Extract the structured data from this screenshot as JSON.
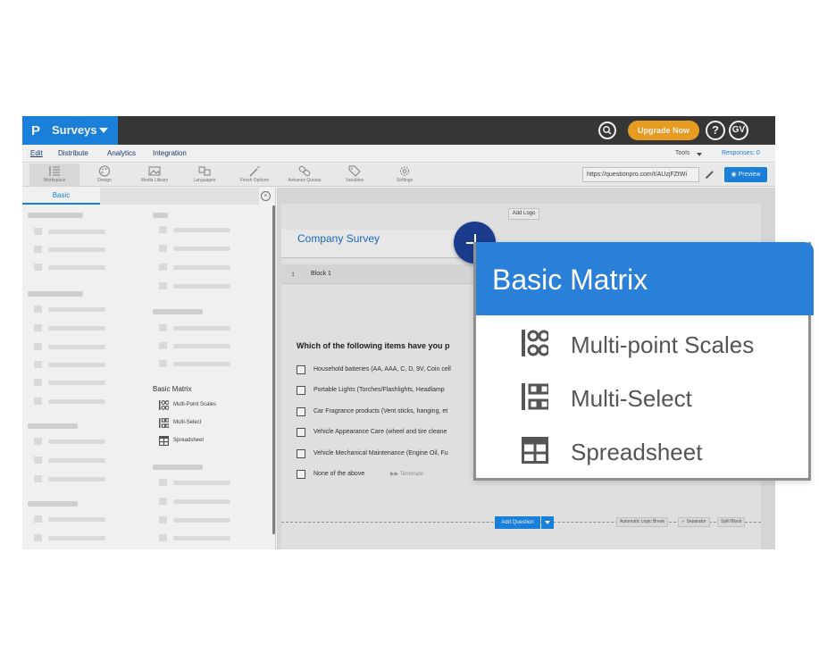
{
  "topbar": {
    "logo": "P",
    "app_name": "Surveys",
    "upgrade_label": "Upgrade Now",
    "help_label": "?",
    "avatar_initials": "GV"
  },
  "nav": {
    "tabs": [
      "Edit",
      "Distribute",
      "Analytics",
      "Integration"
    ],
    "tools_label": "Tools",
    "responses_label": "Responses: 0"
  },
  "toolbar": {
    "items": [
      "Workspace",
      "Design",
      "Media Library",
      "Languages",
      "Finish Options",
      "Advance Quotas",
      "Variables",
      "Settings"
    ],
    "url": "https://questionpro.com/t/AUzjFZtWi",
    "preview_label": "Preview"
  },
  "panel": {
    "tab_label": "Basic",
    "basic_matrix": {
      "heading": "Basic Matrix",
      "items": [
        "Multi-Point Scales",
        "Multi-Select",
        "Spreadsheet"
      ]
    }
  },
  "editor": {
    "add_logo": "Add Logo",
    "survey_title": "Company Survey",
    "block_label": "Block 1",
    "question": "Which of the following items have you p",
    "options": [
      "Household batteries (AA, AAA, C, D, 9V, Coin cell",
      "Portable Lights (Torches/Flashlights, Headlamp",
      "Car Fragrance products (Vent sticks, hanging, et",
      "Vehicle Appearance Care (wheel and tire cleane",
      "Vehicle Mechanical Maintenance (Engine Oil, Fu",
      "None of the above"
    ],
    "terminate_label": "Terminate",
    "add_question": "Add Question",
    "footer_actions": [
      "Automatic Logic Break",
      "Separator",
      "Split Block"
    ]
  },
  "popup": {
    "title": "Basic Matrix",
    "items": [
      "Multi-point Scales",
      "Multi-Select",
      "Spreadsheet"
    ]
  },
  "colors": {
    "brand_blue": "#1b87e6",
    "popup_header": "#2a7fd8",
    "plus_button": "#1b3b8c",
    "upgrade": "#f5a623",
    "topbar": "#3a3a3a"
  }
}
